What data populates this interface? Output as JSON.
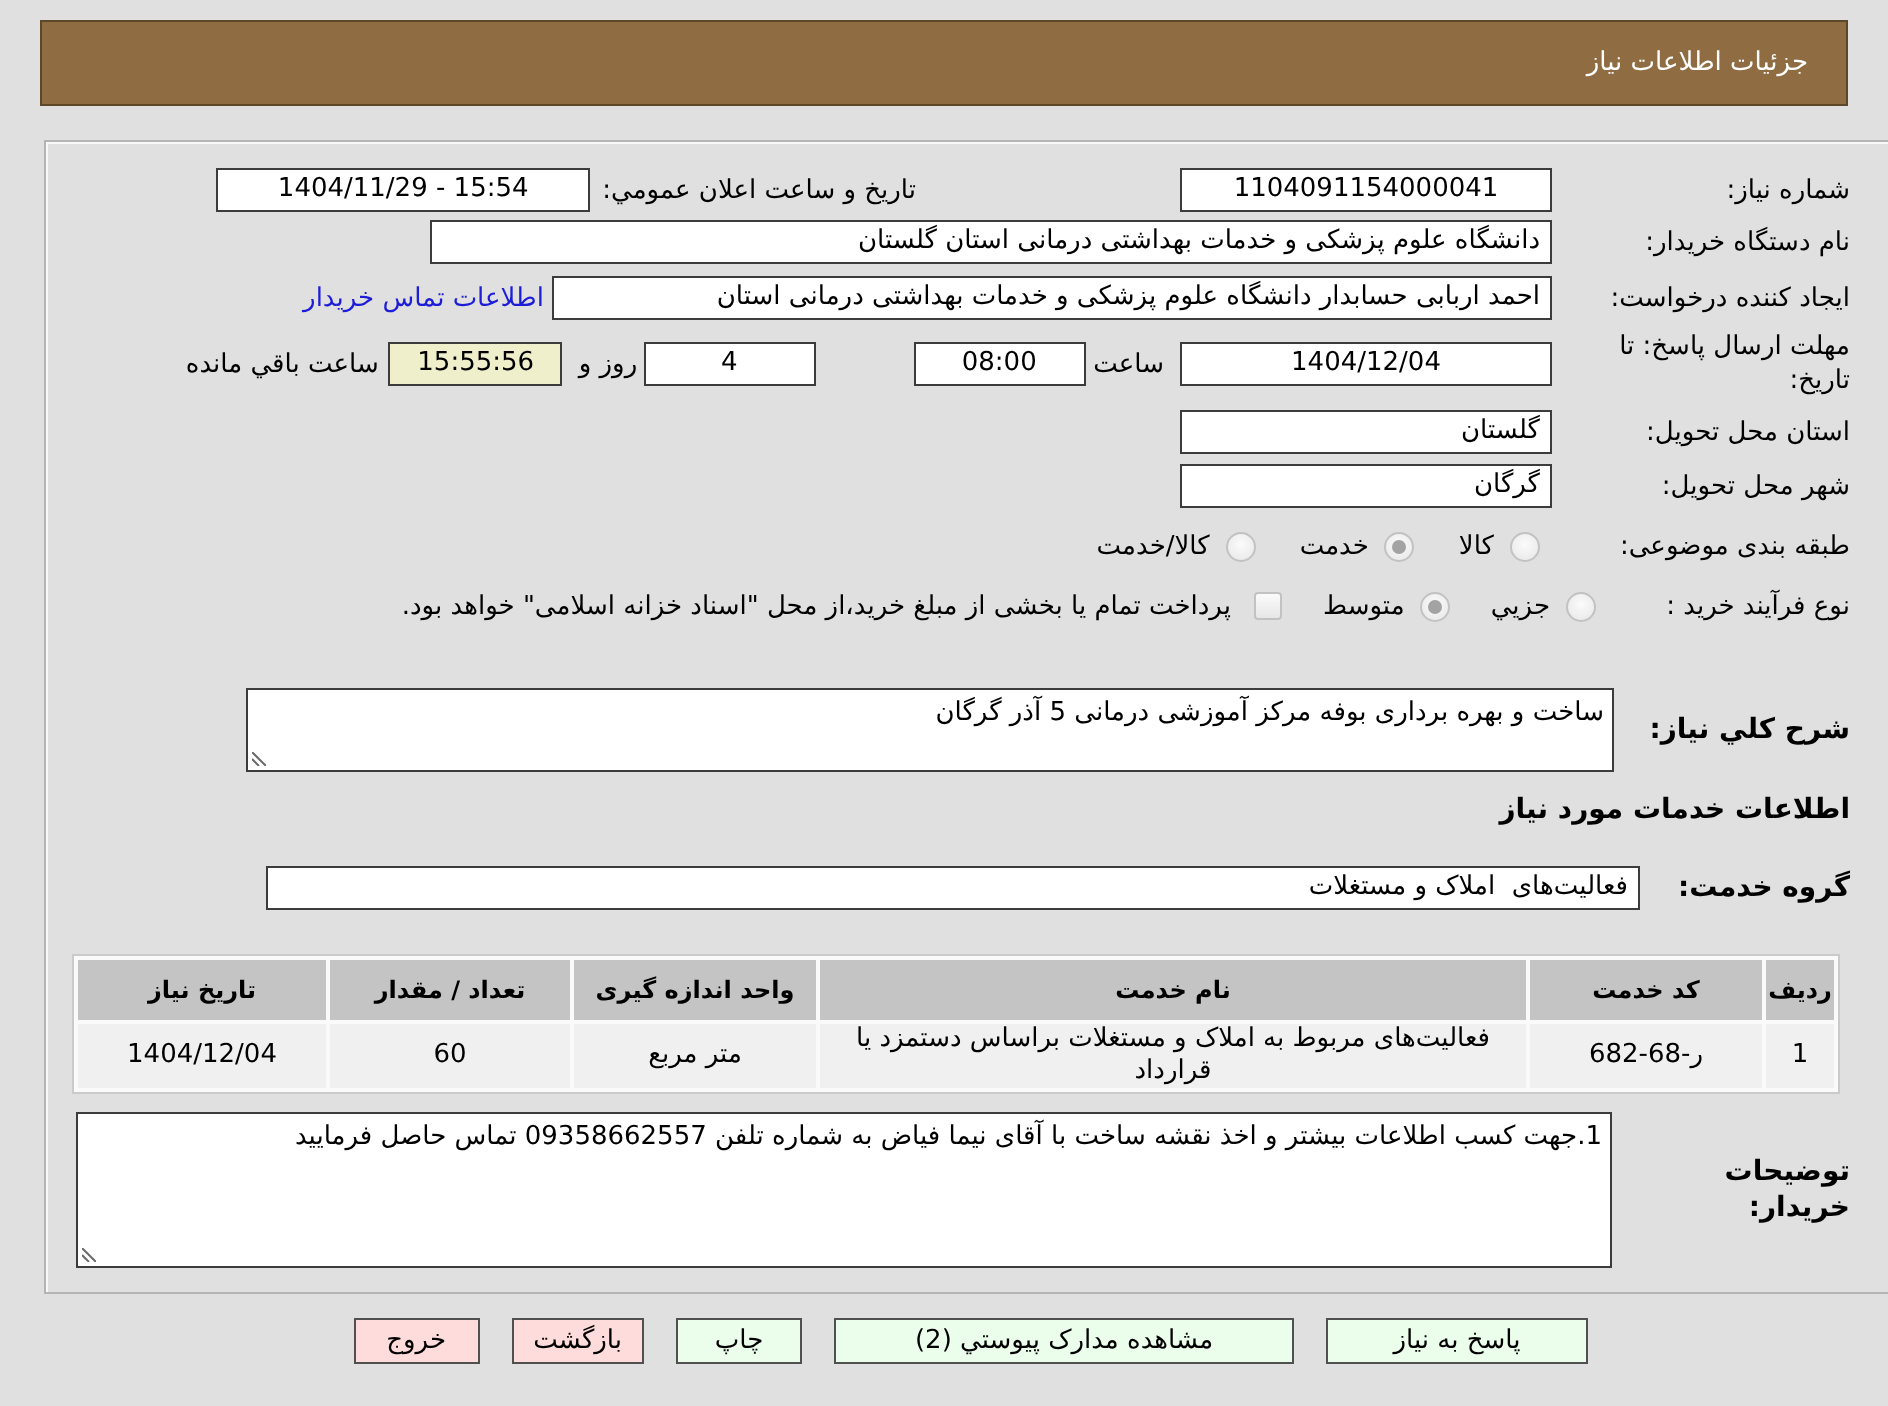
{
  "header": {
    "title": "جزئیات اطلاعات نیاز"
  },
  "details": {
    "need_number": {
      "label": "شماره نیاز:",
      "value": "1104091154000041"
    },
    "announcement": {
      "label": "تاریخ و ساعت اعلان عمومي:",
      "value": "1404/11/29 - 15:54"
    },
    "buyer_organization": {
      "label": "نام دستگاه خریدار:",
      "value": "دانشگاه علوم پزشکی و خدمات بهداشتی درمانی استان گلستان"
    },
    "requester": {
      "label": "ایجاد کننده درخواست:",
      "value": "احمد اربابی حسابدار دانشگاه علوم پزشکی و خدمات بهداشتی درمانی استان",
      "link": "اطلاعات تماس خریدار"
    },
    "deadline": {
      "label": "مهلت ارسال پاسخ: تا تاریخ:",
      "date": "1404/12/04",
      "time_label": "ساعت",
      "time": "08:00",
      "days": "4",
      "days_label": "روز و",
      "remaining": "15:55:56",
      "remaining_label": "ساعت باقي مانده"
    },
    "delivery_province": {
      "label": "استان محل تحویل:",
      "value": "گلستان"
    },
    "delivery_city": {
      "label": "شهر محل تحویل:",
      "value": "گرگان"
    },
    "category": {
      "label": "طبقه بندی موضوعی:",
      "options": [
        {
          "label": "کالا",
          "selected": false
        },
        {
          "label": "خدمت",
          "selected": true
        },
        {
          "label": "کالا/خدمت",
          "selected": false
        }
      ]
    },
    "purchase_process": {
      "label": "نوع فرآیند خرید :",
      "options": [
        {
          "label": "جزيي",
          "selected": false
        },
        {
          "label": "متوسط",
          "selected": true
        }
      ],
      "treasury_payment": {
        "label": "پرداخت تمام یا بخشی از مبلغ خرید،از محل \"اسناد خزانه اسلامی\" خواهد بود.",
        "checked": false
      }
    }
  },
  "description": {
    "label": "شرح کلي نیاز:",
    "value": "ساخت و بهره برداری بوفه مرکز آموزشی درمانی 5 آذر گرگان"
  },
  "services": {
    "heading": "اطلاعات خدمات مورد نیاز",
    "group": {
      "label": "گروه خدمت:",
      "value": "فعالیت‌های  املاک و مستغلات"
    },
    "table": {
      "columns": [
        "ردیف",
        "کد خدمت",
        "نام خدمت",
        "واحد اندازه گیری",
        "تعداد / مقدار",
        "تاریخ نیاز"
      ],
      "rows": [
        [
          "1",
          "ر-68-682",
          "فعالیت‌های مربوط به املاک و مستغلات براساس دستمزد یا قرارداد",
          "متر مربع",
          "60",
          "1404/12/04"
        ]
      ]
    }
  },
  "buyer_notes": {
    "label": "توضیحات خریدار:",
    "value": "1.جهت کسب اطلاعات بیشتر و اخذ نقشه ساخت با آقای نیما فیاض به شماره تلفن 09358662557 تماس حاصل فرمایید"
  },
  "buttons": [
    {
      "label": "پاسخ به نیاز",
      "kind": "action"
    },
    {
      "label": "مشاهده مدارک پیوستي (2)",
      "kind": "action"
    },
    {
      "label": "چاپ",
      "kind": "action"
    },
    {
      "label": "بازگشت",
      "kind": "exit"
    },
    {
      "label": "خروج",
      "kind": "exit"
    }
  ]
}
